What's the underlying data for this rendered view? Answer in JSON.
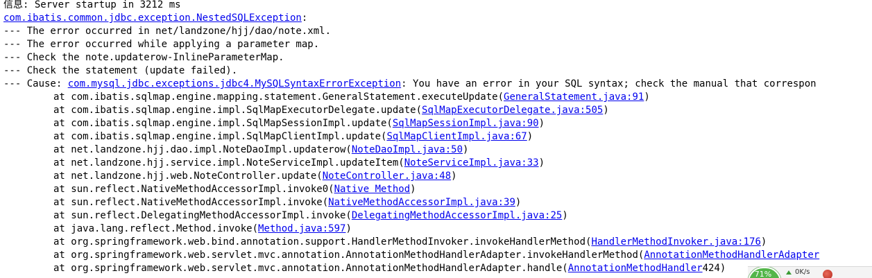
{
  "console": {
    "line1": "信息: Server startup in 3212 ms",
    "exception_class": "com.ibatis.common.jdbc.exception.NestedSQLException",
    "exception_suffix": ":",
    "line3": "--- The error occurred in net/landzone/hjj/dao/note.xml.",
    "line4": "--- The error occurred while applying a parameter map.",
    "line5": "--- Check the note.updaterow-InlineParameterMap.",
    "line6": "--- Check the statement (update failed).",
    "cause_prefix": "--- Cause: ",
    "cause_class": "com.mysql.jdbc.exceptions.jdbc4.MySQLSyntaxErrorException",
    "cause_message": ": You have an error in your SQL syntax; check the manual that correspon",
    "stack": [
      {
        "pre": "at com.ibatis.sqlmap.engine.mapping.statement.GeneralStatement.executeUpdate(",
        "link": "GeneralStatement.java:91",
        "post": ")"
      },
      {
        "pre": "at com.ibatis.sqlmap.engine.impl.SqlMapExecutorDelegate.update(",
        "link": "SqlMapExecutorDelegate.java:505",
        "post": ")"
      },
      {
        "pre": "at com.ibatis.sqlmap.engine.impl.SqlMapSessionImpl.update(",
        "link": "SqlMapSessionImpl.java:90",
        "post": ")"
      },
      {
        "pre": "at com.ibatis.sqlmap.engine.impl.SqlMapClientImpl.update(",
        "link": "SqlMapClientImpl.java:67",
        "post": ")"
      },
      {
        "pre": "at net.landzone.hjj.dao.impl.NoteDaoImpl.updaterow(",
        "link": "NoteDaoImpl.java:50",
        "post": ")"
      },
      {
        "pre": "at net.landzone.hjj.service.impl.NoteServiceImpl.updateItem(",
        "link": "NoteServiceImpl.java:33",
        "post": ")"
      },
      {
        "pre": "at net.landzone.hjj.web.NoteController.update(",
        "link": "NoteController.java:48",
        "post": ")"
      },
      {
        "pre": "at sun.reflect.NativeMethodAccessorImpl.invoke0(",
        "link": "Native Method",
        "post": ")"
      },
      {
        "pre": "at sun.reflect.NativeMethodAccessorImpl.invoke(",
        "link": "NativeMethodAccessorImpl.java:39",
        "post": ")"
      },
      {
        "pre": "at sun.reflect.DelegatingMethodAccessorImpl.invoke(",
        "link": "DelegatingMethodAccessorImpl.java:25",
        "post": ")"
      },
      {
        "pre": "at java.lang.reflect.Method.invoke(",
        "link": "Method.java:597",
        "post": ")"
      },
      {
        "pre": "at org.springframework.web.bind.annotation.support.HandlerMethodInvoker.invokeHandlerMethod(",
        "link": "HandlerMethodInvoker.java:176",
        "post": ")"
      },
      {
        "pre": "at org.springframework.web.servlet.mvc.annotation.AnnotationMethodHandlerAdapter.invokeHandlerMethod(",
        "link": "AnnotationMethodHandlerAdapter",
        "post": ""
      },
      {
        "pre": "at org.springframework.web.servlet.mvc.annotation.AnnotationMethodHandlerAdapter.handle(",
        "link": "AnnotationMethodHandler",
        "post": "424)"
      }
    ]
  },
  "widget": {
    "percent": "71%",
    "speed": "0K/s"
  },
  "colors": {
    "link": "#0000ee",
    "text": "#000000",
    "gauge": "#53b64a"
  }
}
